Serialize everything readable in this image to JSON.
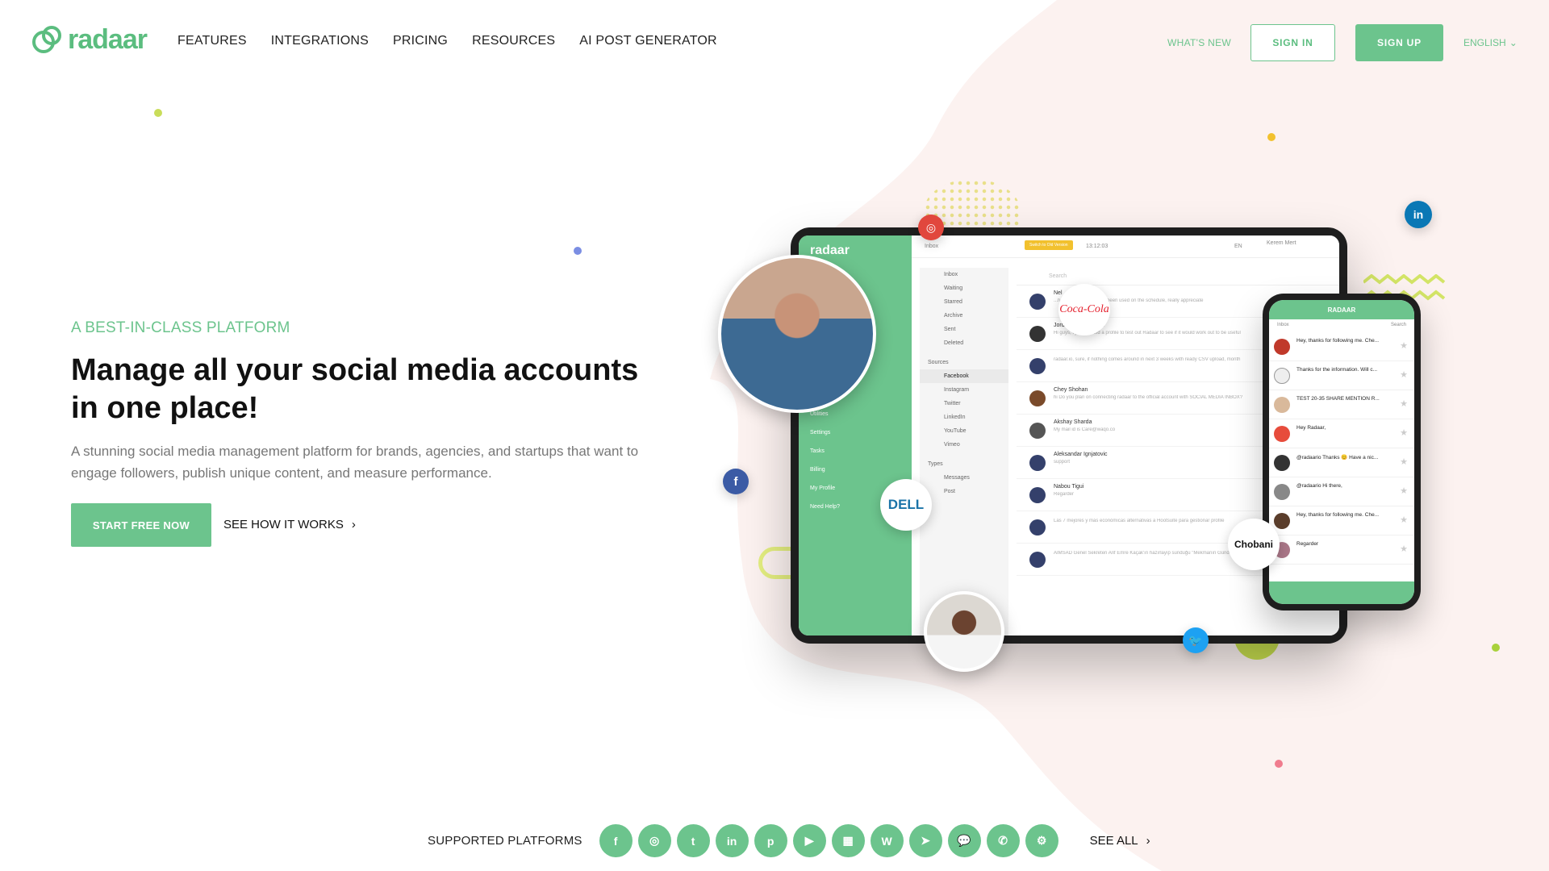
{
  "brand": {
    "name": "radaar",
    "accent": "#6cc48d"
  },
  "nav": {
    "links": [
      "FEATURES",
      "INTEGRATIONS",
      "PRICING",
      "RESOURCES",
      "AI POST GENERATOR"
    ],
    "whats_new": "WHAT'S NEW",
    "sign_in": "SIGN IN",
    "sign_up": "SIGN UP",
    "language": "ENGLISH"
  },
  "hero": {
    "tagline": "A BEST-IN-CLASS PLATFORM",
    "title": "Manage all your social media accounts in one place!",
    "subtitle": "A stunning social media management platform for brands, agencies, and startups that want to engage followers, publish unique content, and measure performance.",
    "cta": "START FREE NOW",
    "secondary": "SEE HOW IT WORKS"
  },
  "mockup": {
    "app_logo": "radaar",
    "inbox_label": "Inbox",
    "switch_button": "Switch to Old Version",
    "time": "13:12:03",
    "lang": "EN",
    "user": "Kerem Mert",
    "search_placeholder": "Search",
    "sidebar_items": [
      "Utilities",
      "Settings",
      "Tasks",
      "Billing",
      "My Profile",
      "Need Help?"
    ],
    "folders": [
      "Inbox",
      "Waiting",
      "Starred",
      "Archive",
      "Sent",
      "Deleted"
    ],
    "sources_label": "Sources",
    "sources": [
      "Facebook",
      "Instagram",
      "Twitter",
      "LinkedIn",
      "YouTube",
      "Vimeo"
    ],
    "types_label": "Types",
    "types": [
      "Messages",
      "Post"
    ],
    "messages": [
      {
        "name": "Nel",
        "text": "...hat social channel has been used on the schedule, really appreciate"
      },
      {
        "name": "Jord K. Christiansen",
        "text": "Hi guys, I just created a profile to test out Radaar to see if it would work out to be useful"
      },
      {
        "name": "",
        "text": "radaar.io, sure, if nothing comes around in next 3 weeks with ready CSV upload, month"
      },
      {
        "name": "Chey Shohan",
        "text": "hi Do you plan on connecting radaar to the official account with SOCIAL MEDIA INBOX?"
      },
      {
        "name": "Akshay Sharda",
        "text": "My mail id is Care@waqo.co"
      },
      {
        "name": "Aleksandar Ignjatovic",
        "text": "support"
      },
      {
        "name": "Nabou Tigui",
        "text": "Regarder"
      },
      {
        "name": "",
        "text": "Las 7 mejores y más económicas alternativas a Hootsuite para gestionar profile"
      },
      {
        "name": "",
        "text": "AIMSAD Genel Sekreteri Arif Emre Kaçak'ın hazırlayıp sunduğu \"Mekmanın Gündemi\" programı"
      }
    ],
    "phone": {
      "title": "RADAAR",
      "inbox": "Inbox",
      "search": "Search",
      "rows": [
        "Hey, thanks for following me. Che...",
        "Thanks for the information. Will c...",
        "TEST 20-35 SHARE MENTION R...",
        "Hey Radaar,",
        "@radaario Thanks 😊 Have a nic...",
        "@radaario Hi there,",
        "Hey, thanks for following me. Che...",
        "Regarder"
      ]
    },
    "brand_badges": [
      "Coca-Cola",
      "DELL",
      "Chobani"
    ]
  },
  "platforms": {
    "label": "SUPPORTED PLATFORMS",
    "icons": [
      "facebook-icon",
      "instagram-icon",
      "twitter-icon",
      "linkedin-icon",
      "pinterest-icon",
      "youtube-icon",
      "google-my-business-icon",
      "wordpress-icon",
      "telegram-icon",
      "messenger-icon",
      "whatsapp-icon",
      "settings-icon"
    ],
    "glyphs": [
      "f",
      "◎",
      "t",
      "in",
      "p",
      "▶",
      "▦",
      "W",
      "➤",
      "💬",
      "✆",
      "⚙"
    ],
    "see_all": "SEE ALL"
  }
}
